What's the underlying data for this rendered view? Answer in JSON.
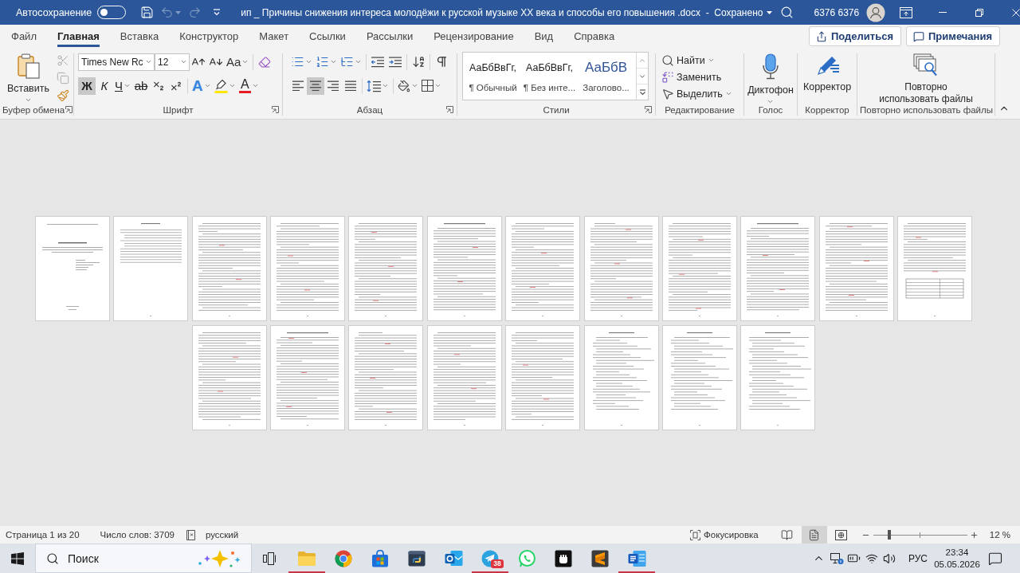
{
  "title_bar": {
    "autosave_label": "Автосохранение",
    "autosave_on": false,
    "undo": {
      "disabled": true
    },
    "redo": {
      "disabled": true
    },
    "document_title": "ип _ Причины снижения интереса молодёжи к русской музыке XX века и способы его повышения .docx  -  Сохранено",
    "user_name": "6376 6376"
  },
  "ribbon_tabs": [
    {
      "label": "Файл",
      "selected": false
    },
    {
      "label": "Главная",
      "selected": true
    },
    {
      "label": "Вставка",
      "selected": false
    },
    {
      "label": "Конструктор",
      "selected": false
    },
    {
      "label": "Макет",
      "selected": false
    },
    {
      "label": "Ссылки",
      "selected": false
    },
    {
      "label": "Рассылки",
      "selected": false
    },
    {
      "label": "Рецензирование",
      "selected": false
    },
    {
      "label": "Вид",
      "selected": false
    },
    {
      "label": "Справка",
      "selected": false
    }
  ],
  "ribbon_buttons": [
    "Поделиться",
    "Примечания"
  ],
  "ribbon": {
    "clipboard": {
      "paste": "Вставить",
      "cut": {
        "disabled": true
      },
      "copy": {
        "disabled": true
      },
      "group_label": "Буфер обмена"
    },
    "font": {
      "font_name": "Times New Rc",
      "font_size": "12",
      "change_case": "Aa",
      "formats": [
        {
          "label": "Ж",
          "selected": true
        },
        {
          "label": "К",
          "selected": false
        },
        {
          "label": "Ч",
          "selected": false
        },
        {
          "label": "ab",
          "selected": false
        }
      ],
      "text_effects": "A",
      "font_color": "A",
      "group_label": "Шрифт"
    },
    "paragraph": {
      "alignment": [
        {
          "selected": false
        },
        {
          "selected": true
        },
        {
          "selected": false
        },
        {
          "selected": false
        }
      ],
      "group_label": "Абзац"
    },
    "styles": {
      "items": [
        {
          "kind": "body",
          "preview": "АаБбВвГг,",
          "name": "¶ Обычный"
        },
        {
          "kind": "body",
          "preview": "АаБбВвГг,",
          "name": "¶ Без инте..."
        },
        {
          "kind": "heading",
          "preview": "АаБбВ",
          "name": "Заголово..."
        }
      ],
      "group_label": "Стили"
    },
    "editing": {
      "items": [
        "Найти",
        "Заменить",
        "Выделить"
      ],
      "group_label": "Редактирование"
    },
    "voice": {
      "label": "Диктофон",
      "group_label": "Голос"
    },
    "corrector": {
      "label": "Корректор",
      "group_label": "Корректор"
    },
    "reuse": {
      "label": "Повторно использовать файлы",
      "group_label": "Повторно использовать файлы"
    }
  },
  "document": {
    "pages": [
      {
        "kind": "title"
      },
      {
        "kind": "contents"
      },
      {
        "kind": "text"
      },
      {
        "kind": "text"
      },
      {
        "kind": "text"
      },
      {
        "kind": "text"
      },
      {
        "kind": "text"
      },
      {
        "kind": "text"
      },
      {
        "kind": "text"
      },
      {
        "kind": "text"
      },
      {
        "kind": "text"
      },
      {
        "kind": "table"
      },
      {
        "kind": "text"
      },
      {
        "kind": "text"
      },
      {
        "kind": "text"
      },
      {
        "kind": "text"
      },
      {
        "kind": "text"
      },
      {
        "kind": "list"
      },
      {
        "kind": "list"
      },
      {
        "kind": "list"
      }
    ]
  },
  "status_bar": {
    "page": "Страница 1 из 20",
    "words": "Число слов: 3709",
    "language": "русский",
    "focus": "Фокусировка",
    "views": [
      {
        "selected": false
      },
      {
        "selected": true
      },
      {
        "selected": false
      }
    ],
    "zoom": {
      "level": 0.17,
      "reading": "12 %"
    }
  },
  "taskbar": {
    "search": {
      "placeholder": "Поиск"
    },
    "apps": [
      {
        "running": true
      },
      {
        "running": false
      },
      {
        "running": false
      },
      {
        "running": false
      },
      {
        "running": false
      },
      {
        "running": true,
        "badge": "38"
      },
      {
        "running": false
      },
      {
        "running": false
      },
      {
        "running": false
      },
      {
        "running": true
      }
    ],
    "language": "РУС",
    "time": "23:34",
    "date": "05.05.2026"
  }
}
